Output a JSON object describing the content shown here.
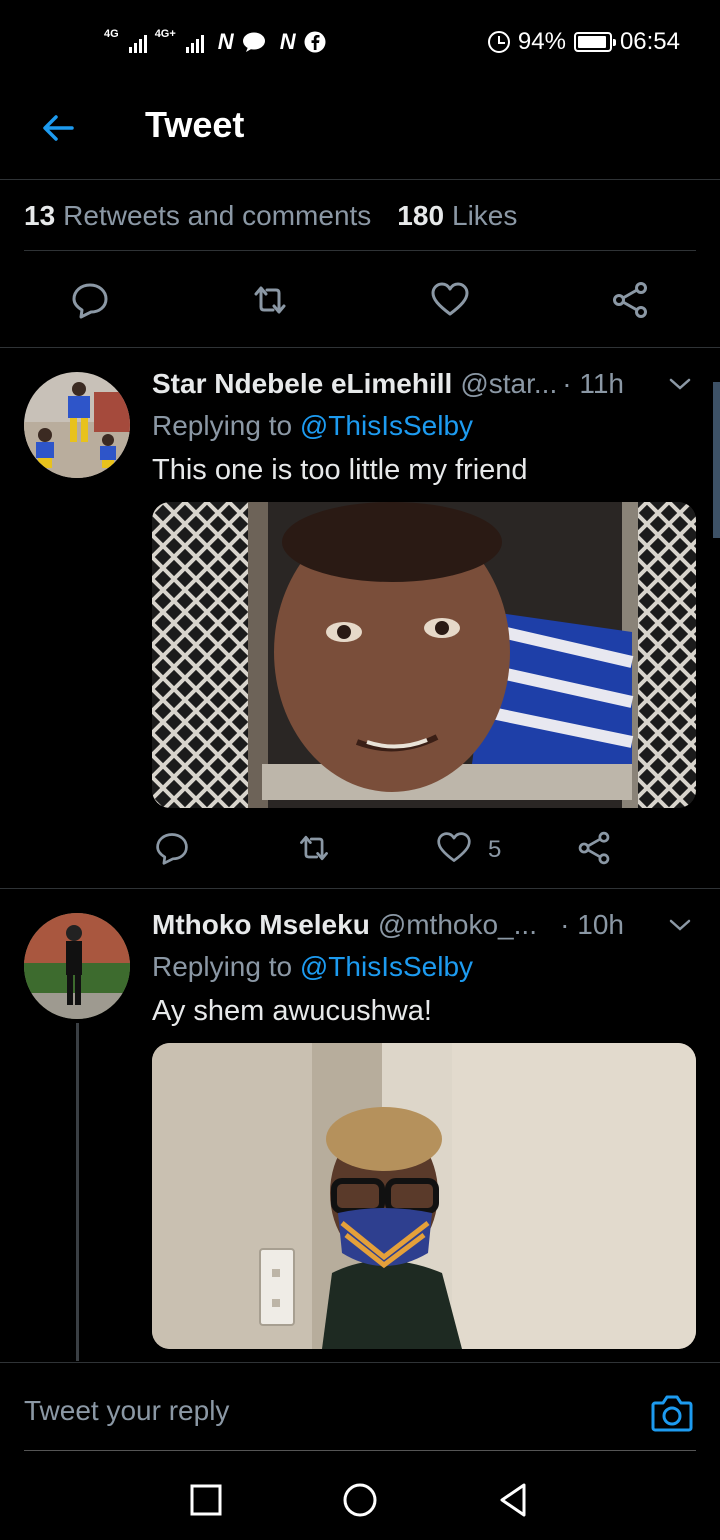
{
  "status_bar": {
    "network_1": "4G",
    "network_2": "4G+",
    "notification_icons": [
      "N",
      "chat",
      "N",
      "facebook"
    ],
    "battery": "94%",
    "battery_level": 0.94,
    "time": "06:54"
  },
  "header": {
    "title": "Tweet"
  },
  "stats": {
    "retweets_count": "13",
    "retweets_label": "Retweets and comments",
    "likes_count": "180",
    "likes_label": "Likes"
  },
  "tweets": [
    {
      "name": "Star Ndebele eLimehill",
      "handle": "@star...",
      "time": "· 11h",
      "replying_prefix": "Replying to",
      "replying_to": "@ThisIsSelby",
      "text": "This one is too little my friend",
      "like_count": "5"
    },
    {
      "name": "Mthoko Mseleku",
      "handle": "@mthoko_...",
      "time": "· 10h",
      "replying_prefix": "Replying to",
      "replying_to": "@ThisIsSelby",
      "text": "Ay shem awucushwa!"
    }
  ],
  "reply_bar": {
    "placeholder": "Tweet your reply"
  },
  "colors": {
    "accent": "#1d9bf0",
    "background": "#000000",
    "muted": "#8b98a5",
    "divider": "#2f3336"
  }
}
